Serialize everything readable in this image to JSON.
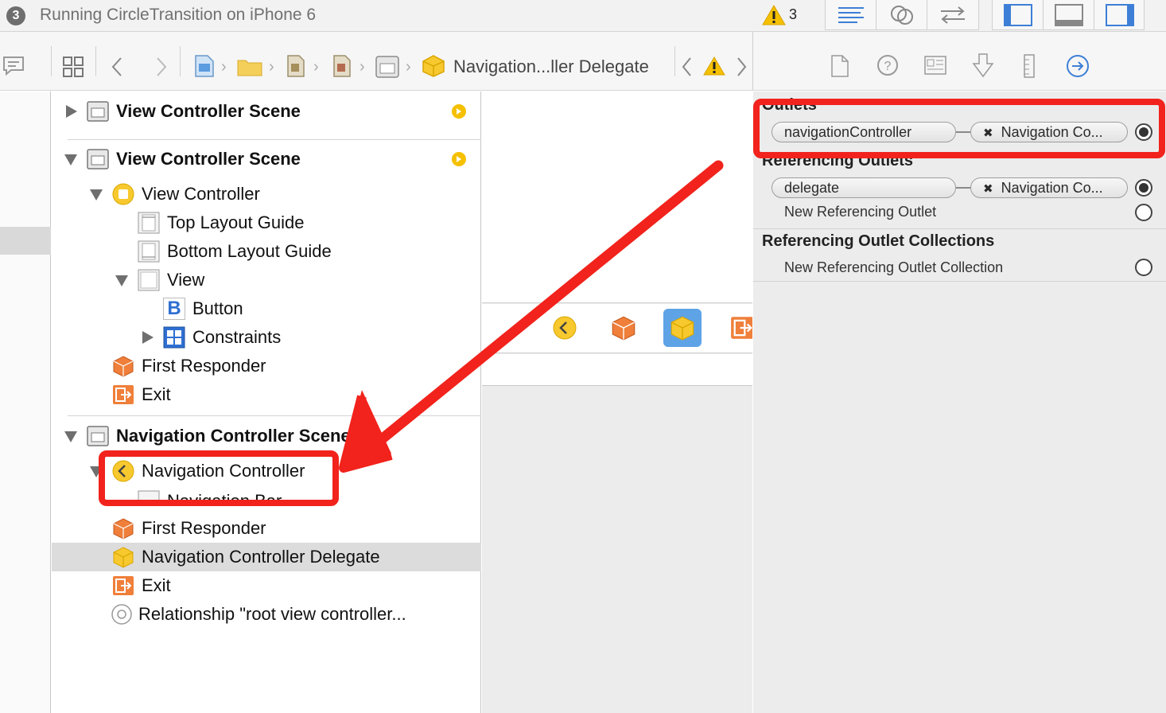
{
  "window": {
    "run_badge": "3",
    "status": "Running CircleTransition on iPhone 6",
    "warning_count": "3"
  },
  "jump_bar": {
    "current": "Navigation...ller Delegate"
  },
  "outline": {
    "scene1": {
      "label": "View Controller Scene"
    },
    "scene2": {
      "label": "View Controller Scene",
      "view_controller": "View Controller",
      "top_layout_guide": "Top Layout Guide",
      "bottom_layout_guide": "Bottom Layout Guide",
      "view": "View",
      "button": "Button",
      "button_icon_letter": "B",
      "constraints": "Constraints",
      "first_responder": "First Responder",
      "exit": "Exit"
    },
    "scene3": {
      "label": "Navigation Controller Scene",
      "navigation_controller": "Navigation Controller",
      "navigation_bar": "Navigation Bar",
      "first_responder": "First Responder",
      "delegate": "Navigation Controller Delegate",
      "exit": "Exit",
      "relationship": "Relationship \"root view controller..."
    }
  },
  "inspector": {
    "outlets": {
      "title": "Outlets",
      "items": [
        {
          "name": "navigationController",
          "target": "Navigation Co...",
          "target_prefix": "✖"
        }
      ]
    },
    "referencing_outlets": {
      "title": "Referencing Outlets",
      "items": [
        {
          "name": "delegate",
          "target": "Navigation Co...",
          "target_prefix": "✖"
        }
      ],
      "new_label": "New Referencing Outlet"
    },
    "referencing_outlet_collections": {
      "title": "Referencing Outlet Collections",
      "new_label": "New Referencing Outlet Collection"
    }
  },
  "colors": {
    "annotation_red": "#f1231c",
    "accent_blue": "#3d7fd6",
    "scene_yellow": "#f5c000",
    "object_orange": "#ef7f3a"
  }
}
